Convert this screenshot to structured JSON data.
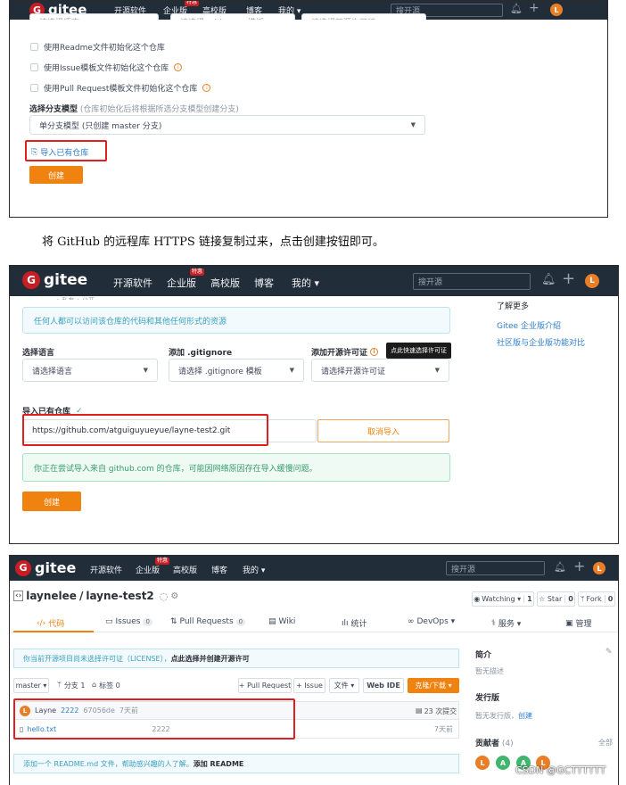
{
  "nav": {
    "brand": "gitee",
    "logo_letter": "G",
    "links": [
      "开源软件",
      "企业版",
      "高校版",
      "博客",
      "我的"
    ],
    "badge": "特惠",
    "my_caret": "▾",
    "search_placeholder": "搜开源",
    "avatar_letter": "L"
  },
  "shot1": {
    "top_inputs": [
      "请选择语言",
      "请选择 .gitignore 模板",
      "请选择开源许可证"
    ],
    "checkboxes": [
      {
        "label": "使用Readme文件初始化这个仓库",
        "help": false
      },
      {
        "label": "使用Issue模板文件初始化这个仓库",
        "help": true
      },
      {
        "label": "使用Pull Request模板文件初始化这个仓库",
        "help": true
      }
    ],
    "branch_label": "选择分支模型",
    "branch_hint": "(仓库初始化后将根据所选分支模型创建分支)",
    "branch_value": "单分支模型 (只创建 master 分支)",
    "import_link": "导入已有仓库",
    "create_button": "创建"
  },
  "caption": "将 GitHub 的远程库 HTTPS 链接复制过来，点击创建按钮即可。",
  "shot2": {
    "partial_top": "• 私有   • 公开",
    "public_hint": "任何人都可以访问该仓库的代码和其他任何形式的资源",
    "lang_label": "选择语言",
    "lang_value": "请选择语言",
    "gitignore_label": "添加 .gitignore",
    "gitignore_value": "请选择 .gitignore 模板",
    "license_label": "添加开源许可证",
    "license_value": "请选择开源许可证",
    "license_tooltip": "点此快速选择许可证",
    "import_label": "导入已有仓库",
    "import_check": "✓",
    "import_url": "https://github.com/atguiguyueyue/layne-test2.git",
    "cancel_import": "取消导入",
    "import_notice": "你正在尝试导入来自 github.com 的仓库，可能因网络原因存在导入缓慢问题。",
    "create_button": "创建",
    "side_title": "了解更多",
    "side_links": [
      "Gitee 企业版介绍",
      "社区版与企业版功能对比"
    ]
  },
  "shot3": {
    "repo_owner": "laynelee",
    "repo_sep": " / ",
    "repo_name": "layne-test2",
    "watching": "Watching ▾",
    "watching_count": "1",
    "star": "☆ Star",
    "star_count": "0",
    "fork": "Fork",
    "fork_count": "0",
    "tabs": [
      {
        "label": "代码",
        "count": ""
      },
      {
        "label": "Issues",
        "count": "0"
      },
      {
        "label": "Pull Requests",
        "count": "0"
      },
      {
        "label": "Wiki",
        "count": ""
      },
      {
        "label": "统计",
        "count": ""
      },
      {
        "label": "DevOps ▾",
        "count": ""
      },
      {
        "label": "服务 ▾",
        "count": ""
      },
      {
        "label": "管理",
        "count": ""
      }
    ],
    "license_notice_prefix": "你当前开源项目尚未选择许可证（LICENSE），",
    "license_notice_link": "点此选择并创建开源许可",
    "branch_select": "master ▾",
    "branches": "分支 1",
    "tags": "标签 0",
    "btn_pr": "+ Pull Request",
    "btn_issue": "+ Issue",
    "btn_file": "文件 ▾",
    "btn_webide": "Web IDE",
    "btn_clone": "克隆/下载 ▾",
    "commit_author": "Layne",
    "commit_msg": "2222",
    "commit_hash": "67056de",
    "commit_time": "7天前",
    "commit_count": "23 次提交",
    "file_name": "hello.txt",
    "file_msg": "2222",
    "file_time": "7天前",
    "readme_prefix": "添加一个 README.md 文件，帮助感兴趣的人了解。",
    "readme_link": "添加 README",
    "side_intro": "简介",
    "side_intro_text": "暂无描述",
    "side_release": "发行版",
    "side_release_text": "暂无发行版，",
    "side_release_link": "创建",
    "side_contrib": "贡献者",
    "side_contrib_count": "(4)",
    "side_contrib_all": "全部",
    "contributors": [
      "L",
      "A",
      "A",
      "L"
    ]
  },
  "watermark": "CSDN @GCTTTTTT",
  "colors": {
    "nav": "#222d3a",
    "brand_red": "#c71d23",
    "orange": "#f0820f",
    "highlight_red": "#e02020",
    "link_blue": "#2f7ec9",
    "notice_green": "#3a9d6e"
  }
}
